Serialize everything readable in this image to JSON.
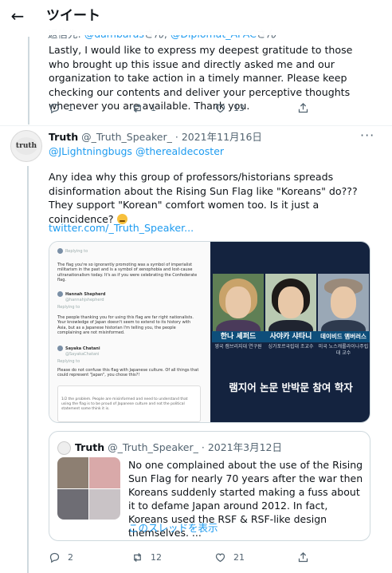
{
  "header": {
    "title": "ツイート"
  },
  "tweet1": {
    "reply_to_prefix": "返信先: ",
    "reply_to_1": "@dambaras",
    "reply_to_mid": "さん, ",
    "reply_to_2": "@Diplomat_APAC",
    "reply_to_suffix": "さん",
    "text": "Lastly, I would like to express my deepest gratitude to those who brought up this issue and directly asked me and our organization to take action in a timely manner. Please keep checking our contents and deliver your perceptive thoughts whenever you are available. Thank you.",
    "replies": "1",
    "retweets": "1",
    "likes": "13"
  },
  "tweet2": {
    "avatar_text": "truth",
    "name": "Truth",
    "handle": "@_Truth_Speaker_",
    "sep": "·",
    "date": "2021年11月16日",
    "more": "···",
    "mention_1": "@JLightningbugs",
    "mention_2": "@therealdecoster",
    "text": "Any idea why this group of professors/historians spreads disinformation about the Rising Sun Flag like \"Koreans\" do??? They support \"Korean\" comfort women too. Is it just a coincidence?",
    "link": "twitter.com/_Truth_Speaker...",
    "media": {
      "left": {
        "replying_1": "Replying to",
        "text_1": "The flag you're so ignorantly promoting was a symbol of imperialist militarism in the past and is a symbol of xenophobia and lost-cause ultranationalism today. It's as if you were celebrating the Confederate flag.",
        "name_2": "Hannah Shepherd",
        "handle_2": "@hannahjshepherd",
        "replying_2": "Replying to",
        "text_2": "The people thanking you for using this flag are far right nationalists. Your knowledge of Japan doesn't seem to extend to its history with Asia, but as a Japanese historian I'm telling you, the people complaining are not misinformed.",
        "name_3": "Sayaka Chatani",
        "handle_3": "@SayakaChatani",
        "replying_3": "Replying to",
        "text_3": "Please do not confuse this flag with Japanese culture. Of all things that could represent \"Japan\", you chose this?!",
        "card_text": "1/2 the problem. People are misinformed and need to understand that using the flag is to be proud of Japanese culture and not the political statement some think it is."
      },
      "right": {
        "people": [
          {
            "name": "한나 셰퍼드",
            "affil": "영국 캠브리지대 연구원"
          },
          {
            "name": "사야카 샤타니",
            "affil": "싱가포르국립대 조교수"
          },
          {
            "name": "데이비드 앰버러스",
            "affil": "미국 노스캐롤라이나주립대 교수"
          }
        ],
        "caption": "램지어 논문 반박문 참여 학자"
      }
    },
    "quote": {
      "name": "Truth",
      "handle": "@_Truth_Speaker_",
      "sep": "·",
      "date": "2021年3月12日",
      "text": "No one complained about the use of the Rising Sun Flag for nearly 70 years after the war then Koreans suddenly started making a fuss about it to defame Japan around 2012. In fact, Koreans used the RSF & RSF-like design themselves. ...",
      "show_thread": "このスレッドを表示"
    },
    "replies": "2",
    "retweets": "12",
    "likes": "21"
  },
  "colors": {
    "link": "#1d9bf0",
    "text": "#0f1419",
    "secondary": "#536471"
  }
}
